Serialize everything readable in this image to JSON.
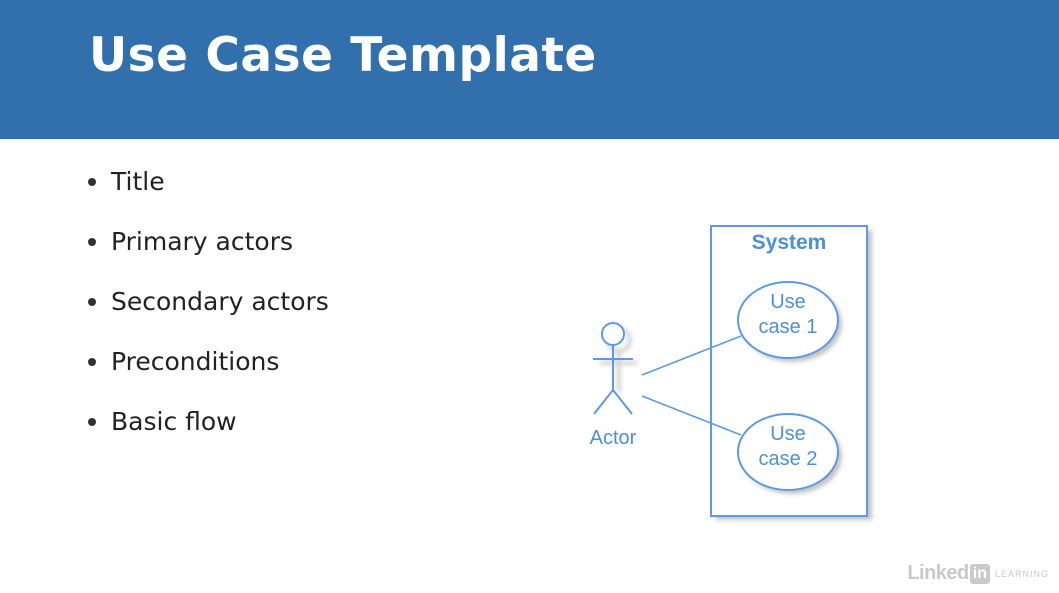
{
  "slide": {
    "title": "Use Case Template",
    "bullets": [
      "Title",
      "Primary actors",
      "Secondary actors",
      "Preconditions",
      "Basic flow"
    ]
  },
  "diagram": {
    "system_label": "System",
    "actor_label": "Actor",
    "use_cases": [
      {
        "line1": "Use",
        "line2": "case 1"
      },
      {
        "line1": "Use",
        "line2": "case 2"
      }
    ],
    "colors": {
      "stroke": "#5b9ae6",
      "text": "#4d8fdc",
      "fill": "#ffffff",
      "shadow": "#c4c4c4"
    }
  },
  "watermark": {
    "brand": "Linked",
    "in": "in",
    "product": "LEARNING"
  },
  "colors": {
    "header_bg": "#3170ad",
    "title_text": "#ffffff",
    "body_text": "#222222"
  }
}
